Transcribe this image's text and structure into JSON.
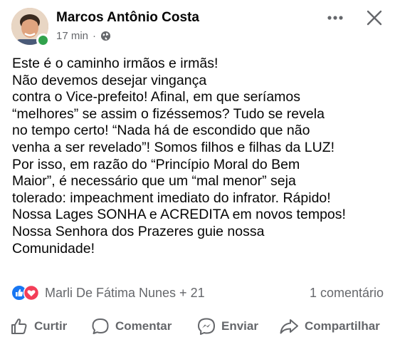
{
  "post": {
    "author": "Marcos Antônio Costa",
    "time": "17 min",
    "separator": "·",
    "text_lines": [
      "Este é o caminho irmãos e irmãs!",
      "Não devemos desejar vingança",
      "contra o Vice-prefeito! Afinal, em que seríamos",
      "“melhores” se assim o fizéssemos? Tudo se revela",
      "no tempo certo! “Nada há de escondido que não",
      "venha a ser revelado”! Somos filhos e filhas da LUZ!",
      "Por isso, em razão do “Princípio Moral do Bem",
      "Maior”, é necessário que um “mal menor” seja",
      "tolerado: impeachment imediato do infrator. Rápido!",
      "Nossa Lages SONHA e ACREDITA em novos tempos!",
      "Nossa Senhora dos Prazeres guie nossa",
      "Comunidade!"
    ]
  },
  "reactions": {
    "icons": [
      "like-icon",
      "love-icon"
    ],
    "reactors": "Marli De Fátima Nunes + 21",
    "comments": "1 comentário"
  },
  "actions": {
    "like": "Curtir",
    "comment": "Comentar",
    "send": "Enviar",
    "share": "Compartilhar"
  },
  "colors": {
    "text": "#050505",
    "secondary": "#65676b",
    "like_blue": "#1877f2",
    "love_red": "#f33e58",
    "online_green": "#31a24c"
  }
}
